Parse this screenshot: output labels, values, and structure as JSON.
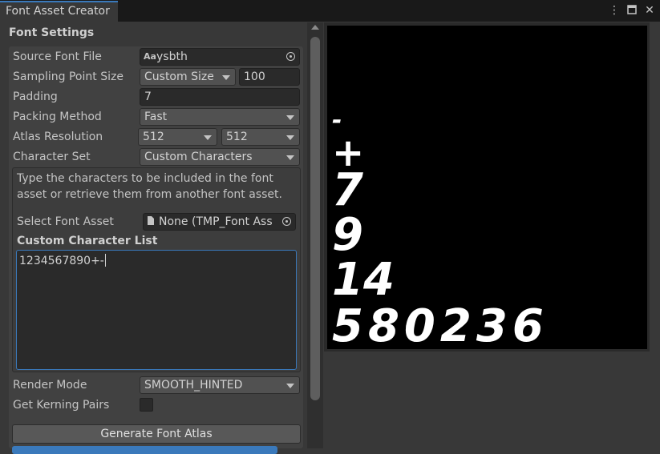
{
  "window": {
    "tab_title": "Font Asset Creator",
    "menu_icon": "kebab-menu-icon",
    "maximize_icon": "maximize-icon",
    "close_icon": "close-icon"
  },
  "font_settings": {
    "section_title": "Font Settings",
    "source_font_file": {
      "label": "Source Font File",
      "value": "ysbth",
      "icon": "font-asset-icon"
    },
    "sampling_point_size": {
      "label": "Sampling Point Size",
      "mode": "Custom Size",
      "value": "100"
    },
    "padding": {
      "label": "Padding",
      "value": "7"
    },
    "packing_method": {
      "label": "Packing Method",
      "value": "Fast"
    },
    "atlas_resolution": {
      "label": "Atlas Resolution",
      "width": "512",
      "height": "512"
    },
    "character_set": {
      "label": "Character Set",
      "value": "Custom Characters"
    },
    "help_text": "Type the characters to be included in the font asset or retrieve them from another font asset.",
    "select_font_asset": {
      "label": "Select Font Asset",
      "value": "None (TMP_Font Ass",
      "icon": "document-icon"
    },
    "custom_character_list": {
      "label": "Custom Character List",
      "value": "1234567890+-"
    },
    "render_mode": {
      "label": "Render Mode",
      "value": "SMOOTH_HINTED"
    },
    "get_kerning_pairs": {
      "label": "Get Kerning Pairs",
      "checked": false
    },
    "generate_button": "Generate Font Atlas"
  },
  "atlas_preview": {
    "rows": [
      "-",
      "+",
      "7",
      "9",
      "14",
      "580236"
    ]
  },
  "colors": {
    "accent": "#3a79bb",
    "background": "#383838",
    "preview_bg": "#000000"
  }
}
